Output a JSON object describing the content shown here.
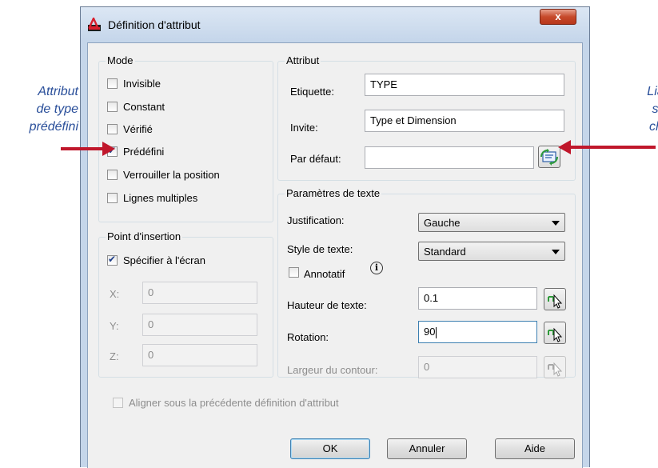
{
  "annotations": {
    "left": [
      "Attribut",
      "de type",
      "prédéfini"
    ],
    "right": [
      "Liaison",
      "sur un",
      "champ"
    ],
    "arrow_color": "#c0172b",
    "text_color": "#2a4f9a"
  },
  "window": {
    "title": "Définition d'attribut",
    "close_label": "x"
  },
  "mode": {
    "legend": "Mode",
    "options": [
      {
        "label": "Invisible",
        "checked": false
      },
      {
        "label": "Constant",
        "checked": false
      },
      {
        "label": "Vérifié",
        "checked": false
      },
      {
        "label": "Prédéfini",
        "checked": true
      },
      {
        "label": "Verrouiller la position",
        "checked": false
      },
      {
        "label": "Lignes multiples",
        "checked": false
      }
    ]
  },
  "insertion": {
    "legend": "Point d'insertion",
    "specify_label": "Spécifier à l'écran",
    "specify_checked": true,
    "x_label": "X:",
    "x_value": "0",
    "y_label": "Y:",
    "y_value": "0",
    "z_label": "Z:",
    "z_value": "0"
  },
  "attribute": {
    "legend": "Attribut",
    "tag_label": "Etiquette:",
    "tag_value": "TYPE",
    "prompt_label": "Invite:",
    "prompt_value": "Type et Dimension",
    "default_label": "Par défaut:",
    "default_value": "",
    "field_icon": "insert-field-icon"
  },
  "text_settings": {
    "legend": "Paramètres de texte",
    "justification_label": "Justification:",
    "justification_value": "Gauche",
    "style_label": "Style de texte:",
    "style_value": "Standard",
    "annotative_label": "Annotatif",
    "annotative_checked": false,
    "height_label": "Hauteur de texte:",
    "height_value": "0.1",
    "rotation_label": "Rotation:",
    "rotation_value": "90",
    "boundary_label": "Largeur du contour:",
    "boundary_value": "0",
    "pick_icon": "pick-point-icon",
    "info_icon": "info-icon"
  },
  "align_label": "Aligner sous la précédente définition d'attribut",
  "buttons": {
    "ok": "OK",
    "cancel": "Annuler",
    "help": "Aide"
  }
}
